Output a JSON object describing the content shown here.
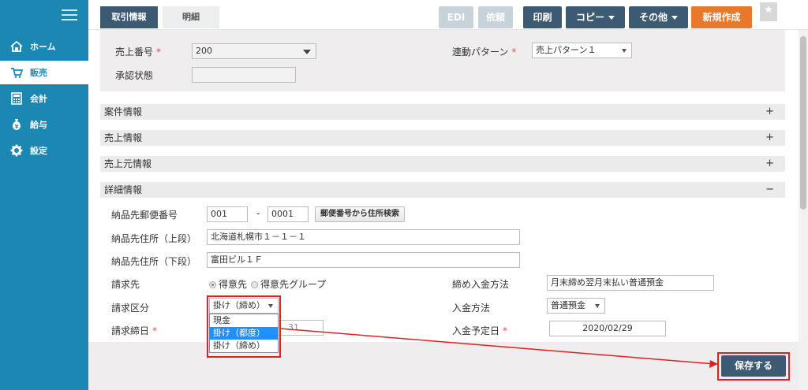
{
  "sidebar": {
    "items": [
      {
        "label": "ホーム",
        "icon": "home-icon"
      },
      {
        "label": "販売",
        "icon": "cart-icon"
      },
      {
        "label": "会計",
        "icon": "calculator-icon"
      },
      {
        "label": "給与",
        "icon": "money-bag-icon"
      },
      {
        "label": "設定",
        "icon": "gear-icon"
      }
    ],
    "active_index": 1
  },
  "tabs": [
    {
      "label": "取引情報",
      "active": true
    },
    {
      "label": "明細",
      "active": false
    }
  ],
  "toolbar": {
    "edi": "EDI",
    "request": "依頼",
    "print": "印刷",
    "copy": "コピー",
    "other": "その他",
    "new": "新規作成"
  },
  "header_form": {
    "sale_number_label": "売上番号",
    "sale_number_value": "200",
    "approval_label": "承認状態",
    "approval_value": "",
    "pattern_label": "連動パターン",
    "pattern_value": "売上パターン１"
  },
  "sections": [
    {
      "label": "案件情報",
      "toggle": "+"
    },
    {
      "label": "売上情報",
      "toggle": "+"
    },
    {
      "label": "売上元情報",
      "toggle": "+"
    },
    {
      "label": "詳細情報",
      "toggle": "−"
    }
  ],
  "detail": {
    "postal_label": "納品先郵便番号",
    "postal_1": "001",
    "postal_sep": "-",
    "postal_2": "0001",
    "postal_button": "郵便番号から住所検索",
    "addr1_label": "納品先住所（上段）",
    "addr1_value": "北海道札幌市１－１－１",
    "addr2_label": "納品先住所（下段）",
    "addr2_value": "富田ビル１Ｆ",
    "bill_to_label": "請求先",
    "bill_to_opt1": "得意先",
    "bill_to_opt2": "得意先グループ",
    "bill_type_label": "請求区分",
    "bill_type_value": "掛け（締め）",
    "bill_close_label": "請求締日",
    "bill_close_partial": "31",
    "closing_method_label": "締め入金方法",
    "closing_method_value": "月末締め翌月末払い普通預金",
    "payment_method_label": "入金方法",
    "payment_method_value": "普通預金",
    "payment_date_label": "入金予定日",
    "payment_date_value": "2020/02/29"
  },
  "dropdown_options": [
    "現金",
    "掛け（都度）",
    "掛け（締め）"
  ],
  "dropdown_selected_index": 1,
  "save_label": "保存する",
  "colors": {
    "sidebar": "#1b87b3",
    "primary": "#3d5a73",
    "orange": "#e8782a",
    "highlight": "#e02020",
    "selected_option": "#1e90ff"
  }
}
